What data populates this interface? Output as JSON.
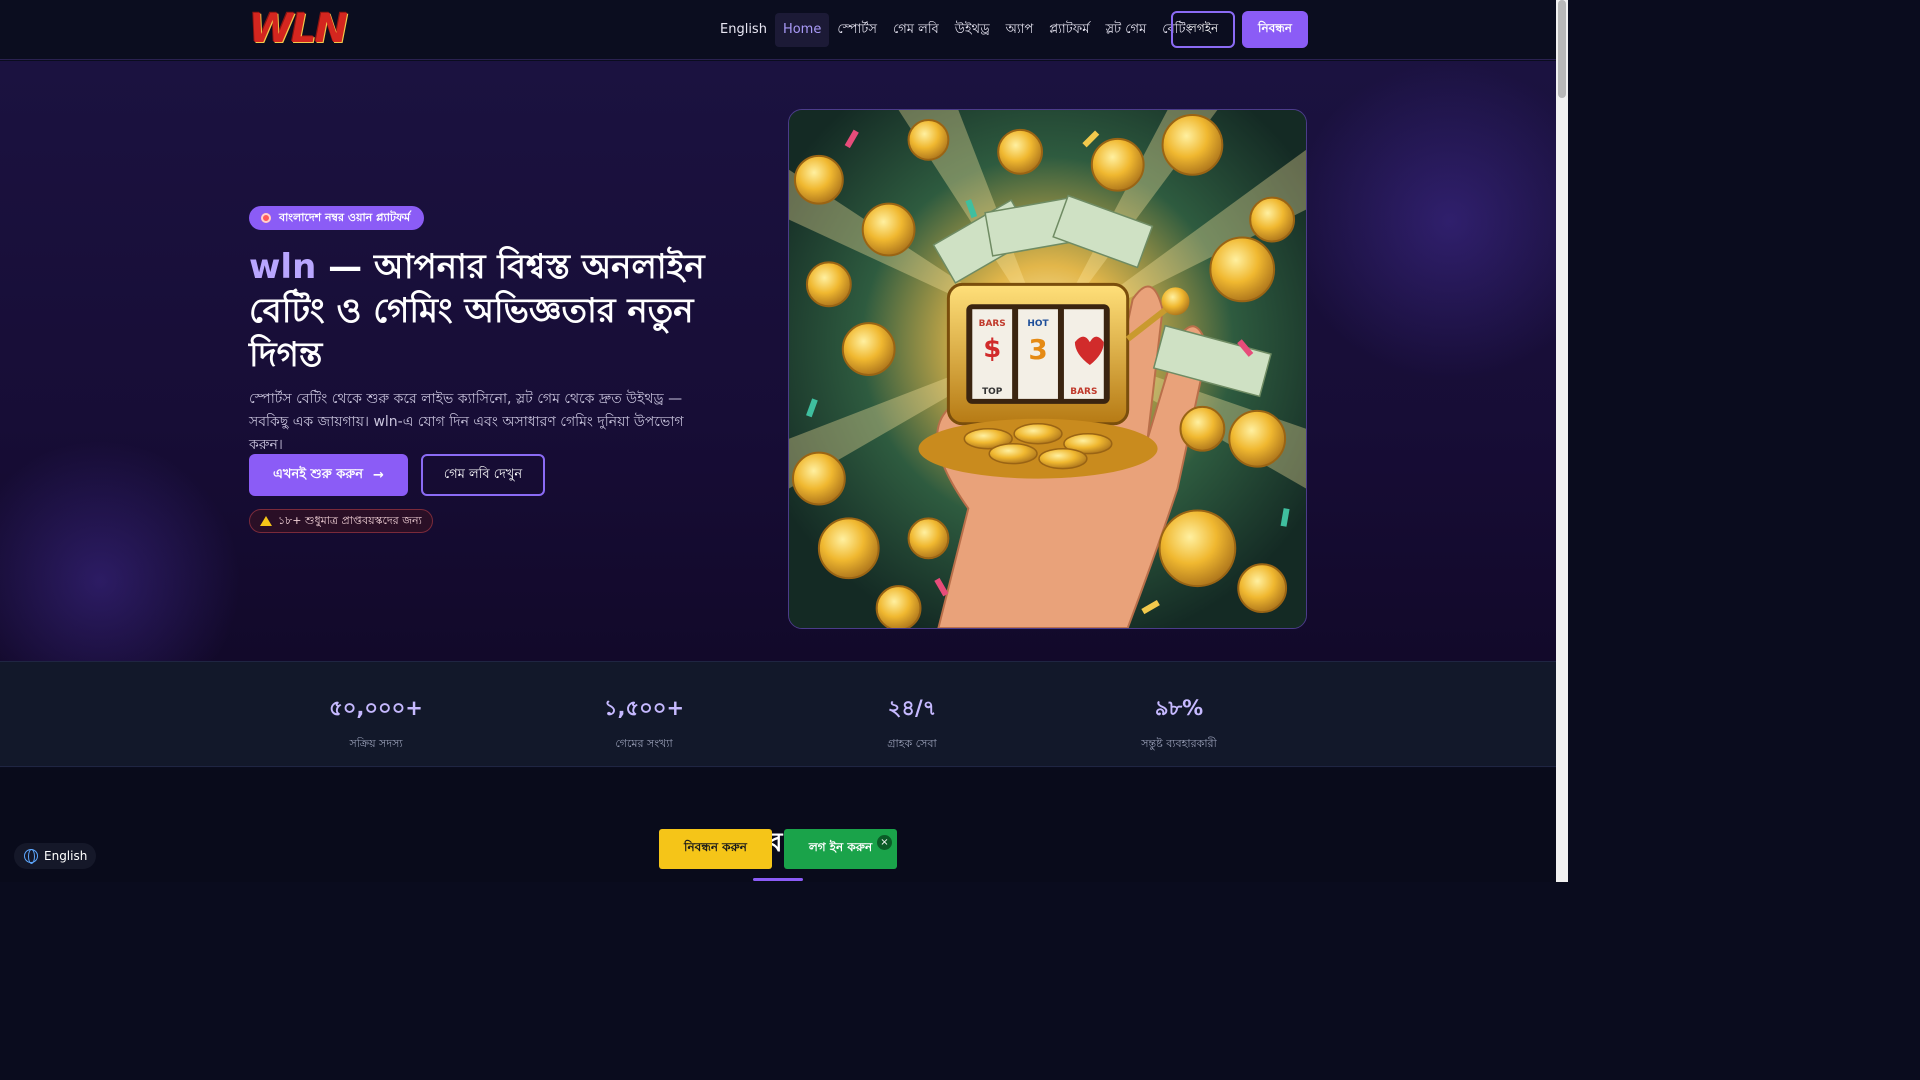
{
  "header": {
    "logo_text": "WLN",
    "nav": [
      {
        "label": "English",
        "active": false
      },
      {
        "label": "Home",
        "active": true
      },
      {
        "label": "স্পোর্টস",
        "active": false
      },
      {
        "label": "গেম লবি",
        "active": false
      },
      {
        "label": "উইথড্র",
        "active": false
      },
      {
        "label": "অ্যাপ",
        "active": false
      },
      {
        "label": "প্ল্যাটফর্ম",
        "active": false
      },
      {
        "label": "স্লট গেম",
        "active": false
      },
      {
        "label": "বেটিং",
        "active": false
      }
    ],
    "login_label": "লগইন",
    "register_label": "নিবন্ধন"
  },
  "hero": {
    "badge": "বাংলাদেশ নম্বর ওয়ান প্ল্যাটফর্ম",
    "title_brand": "wln",
    "title_rest": " — আপনার বিশ্বস্ত অনলাইন বেটিং ও গেমিং অভিজ্ঞতার নতুন দিগন্ত",
    "description": "স্পোর্টস বেটিং থেকে শুরু করে লাইভ ক্যাসিনো, স্লট গেম থেকে দ্রুত উইথড্র — সবকিছু এক জায়গায়। wln-এ যোগ দিন এবং অসাধারণ গেমিং দুনিয়া উপভোগ করুন।",
    "start_button": "এখনই শুরু করুন",
    "start_arrow": "→",
    "lobby_button": "গেম লবি দেখুন",
    "age_notice": "১৮+ শুধুমাত্র প্রাপ্তবয়স্কদের জন্য",
    "image_reel_labels": [
      "BARS",
      "HOT",
      "BAR",
      "TOP",
      "BARS"
    ]
  },
  "stats": [
    {
      "value": "৫০,০০০+",
      "label": "সক্রিয় সদস্য"
    },
    {
      "value": "১,৫০০+",
      "label": "গেমের সংখ্যা"
    },
    {
      "value": "২৪/৭",
      "label": "গ্রাহক সেবা"
    },
    {
      "value": "৯৮%",
      "label": "সন্তুষ্ট ব্যবহারকারী"
    }
  ],
  "lower": {
    "section_title_peek": "ব"
  },
  "sticky": {
    "register": "নিবন্ধন করুন",
    "login": "লগ ইন করুন",
    "close": "×"
  },
  "language_pill": "English",
  "colors": {
    "accent": "#8b5cf6",
    "sticky_register": "#f5c518",
    "sticky_login": "#1aa34a"
  }
}
